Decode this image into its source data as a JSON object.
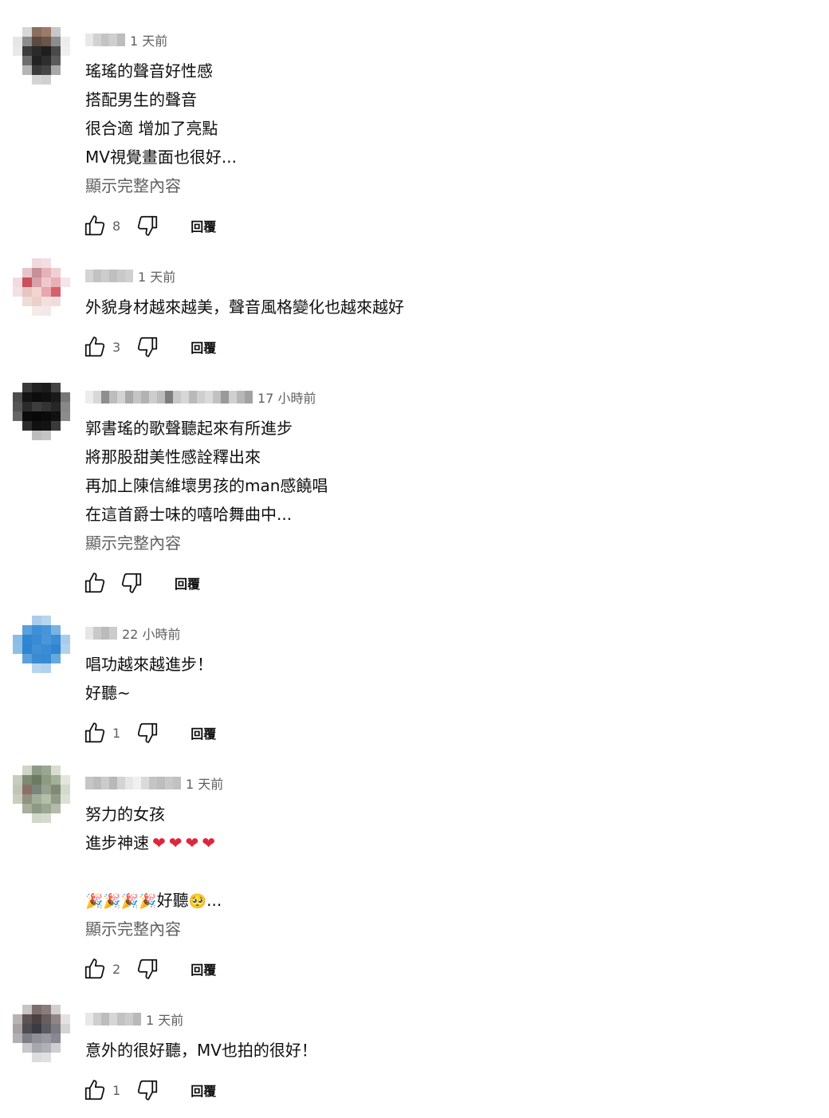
{
  "icons": {
    "like": "thumb-up-icon",
    "dislike": "thumb-down-icon"
  },
  "colors": {
    "text": "#0f0f0f",
    "secondary": "#606060",
    "heart": "#e0263a"
  },
  "comments": [
    {
      "time": "1 天前",
      "lines": [
        "瑤瑤的聲音好性感",
        "搭配男生的聲音",
        "很合適 增加了亮點",
        "MV視覺畫面也很好..."
      ],
      "show_more": "顯示完整內容",
      "likes": "8",
      "reply": "回覆"
    },
    {
      "time": "1 天前",
      "lines": [
        "外貌身材越來越美，聲音風格變化也越來越好"
      ],
      "likes": "3",
      "reply": "回覆"
    },
    {
      "time": "17 小時前",
      "lines": [
        "郭書瑤的歌聲聽起來有所進步",
        "將那股甜美性感詮釋出來",
        "再加上陳信維壞男孩的man感饒唱",
        "在這首爵士味的嘻哈舞曲中..."
      ],
      "show_more": "顯示完整內容",
      "likes": "",
      "reply": "回覆"
    },
    {
      "time": "22 小時前",
      "lines": [
        "唱功越來越進步！",
        "好聽~"
      ],
      "likes": "1",
      "reply": "回覆"
    },
    {
      "time": "1 天前",
      "lines": [
        "努力的女孩",
        "進步神速",
        "",
        "好聽"
      ],
      "emoji": {
        "heart": "❤",
        "party": "🎉",
        "pleading": "🥺",
        "ellipsis": "..."
      },
      "show_more": "顯示完整內容",
      "likes": "2",
      "reply": "回覆"
    },
    {
      "time": "1 天前",
      "lines": [
        "意外的很好聽，MV也拍的很好！"
      ],
      "likes": "1",
      "reply": "回覆"
    }
  ]
}
